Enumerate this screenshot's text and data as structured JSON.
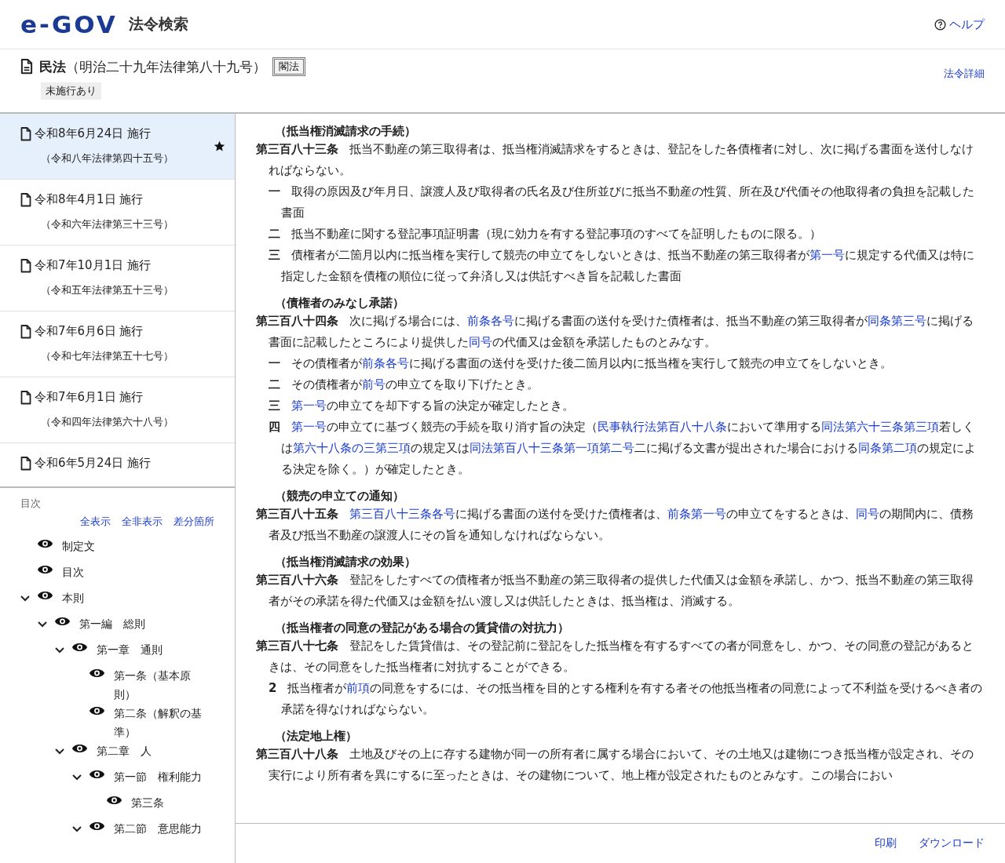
{
  "header": {
    "logo": "e-GOV",
    "service": "法令検索",
    "help": "ヘルプ"
  },
  "law": {
    "title": "**民法**（明治二十九年法律第八十九号）",
    "badge": "閣法",
    "tag": "未施行あり",
    "detail_link": "法令詳細"
  },
  "versions": [
    {
      "date": "令和8年6月24日 施行",
      "law_no": "（令和八年法律第四十五号）",
      "selected": true,
      "starred": true
    },
    {
      "date": "令和8年4月1日 施行",
      "law_no": "（令和六年法律第三十三号）",
      "selected": false,
      "starred": false
    },
    {
      "date": "令和7年10月1日 施行",
      "law_no": "（令和五年法律第五十三号）",
      "selected": false,
      "starred": false
    },
    {
      "date": "令和7年6月6日 施行",
      "law_no": "（令和七年法律第五十七号）",
      "selected": false,
      "starred": false
    },
    {
      "date": "令和7年6月1日 施行",
      "law_no": "（令和四年法律第六十八号）",
      "selected": false,
      "starred": false
    },
    {
      "date": "令和6年5月24日 施行",
      "selected": false,
      "starred": false
    }
  ],
  "toc": {
    "heading": "目次",
    "actions": [
      "全表示",
      "全非表示",
      "差分箇所"
    ],
    "items": [
      {
        "label": "制定文"
      },
      {
        "label": "目次"
      },
      {
        "label": "本則",
        "expanded": true,
        "children": [
          {
            "label": "第一編　総則",
            "expanded": true,
            "children": [
              {
                "label": "第一章　通則",
                "expanded": true,
                "children": [
                  {
                    "label": "第一条（基本原則）"
                  },
                  {
                    "label": "第二条（解釈の基準）"
                  }
                ]
              },
              {
                "label": "第二章　人",
                "expanded": true,
                "children": [
                  {
                    "label": "第一節　権利能力",
                    "expanded": true,
                    "children": [
                      {
                        "label": "第三条"
                      }
                    ]
                  },
                  {
                    "label": "第二節　意思能力",
                    "expanded": true
                  }
                ]
              }
            ]
          }
        ]
      }
    ]
  },
  "articles": [
    {
      "caption": "（抵当権消滅請求の手続）",
      "title": "第三百八十三条",
      "text": [
        {
          "kind": "text",
          "text": "抵当不動産の第三取得者は、抵当権消滅請求をするときは、登記をした各債権者に対し、次に掲げる書面を送付しなければならない。"
        }
      ],
      "items": [
        {
          "label": "一",
          "text": [
            {
              "kind": "text",
              "text": "取得の原因及び年月日、譲渡人及び取得者の氏名及び住所並びに抵当不動産の性質、所在及び代価その他取得者の負担を記載した書面"
            }
          ]
        },
        {
          "label": "二",
          "text": [
            {
              "kind": "text",
              "text": "抵当不動産に関する登記事項証明書（現に効力を有する登記事項のすべてを証明したものに限る。）"
            }
          ]
        },
        {
          "label": "三",
          "text": [
            {
              "kind": "text",
              "text": "債権者が二箇月以内に抵当権を実行して競売の申立てをしないときは、抵当不動産の第三取得者が"
            },
            {
              "kind": "link",
              "text": "第一号"
            },
            {
              "kind": "text",
              "text": "に規定する代価又は特に指定した金額を債権の順位に従って弁済し又は供託すべき旨を記載した書面"
            }
          ]
        }
      ]
    },
    {
      "caption": "（債権者のみなし承諾）",
      "title": "第三百八十四条",
      "text": [
        {
          "kind": "text",
          "text": "次に掲げる場合には、"
        },
        {
          "kind": "link",
          "text": "前条各号"
        },
        {
          "kind": "text",
          "text": "に掲げる書面の送付を受けた債権者は、抵当不動産の第三取得者が"
        },
        {
          "kind": "link",
          "text": "同条第三号"
        },
        {
          "kind": "text",
          "text": "に掲げる書面に記載したところにより提供した"
        },
        {
          "kind": "link",
          "text": "同号"
        },
        {
          "kind": "text",
          "text": "の代価又は金額を承諾したものとみなす。"
        }
      ],
      "items": [
        {
          "label": "一",
          "text": [
            {
              "kind": "text",
              "text": "その債権者が"
            },
            {
              "kind": "link",
              "text": "前条各号"
            },
            {
              "kind": "text",
              "text": "に掲げる書面の送付を受けた後二箇月以内に抵当権を実行して競売の申立てをしないとき。"
            }
          ]
        },
        {
          "label": "二",
          "text": [
            {
              "kind": "text",
              "text": "その債権者が"
            },
            {
              "kind": "link",
              "text": "前号"
            },
            {
              "kind": "text",
              "text": "の申立てを取り下げたとき。"
            }
          ]
        },
        {
          "label": "三",
          "text": [
            {
              "kind": "link",
              "text": "第一号"
            },
            {
              "kind": "text",
              "text": "の申立てを却下する旨の決定が確定したとき。"
            }
          ]
        },
        {
          "label": "四",
          "text": [
            {
              "kind": "link",
              "text": "第一号"
            },
            {
              "kind": "text",
              "text": "の申立てに基づく競売の手続を取り消す旨の決定（"
            },
            {
              "kind": "link",
              "text": "民事執行法第百八十八条"
            },
            {
              "kind": "text",
              "text": "において準用する"
            },
            {
              "kind": "link",
              "text": "同法第六十三条第三項"
            },
            {
              "kind": "text",
              "text": "若しくは"
            },
            {
              "kind": "link",
              "text": "第六十八条の三第三項"
            },
            {
              "kind": "text",
              "text": "の規定又は"
            },
            {
              "kind": "link",
              "text": "同法第百八十三条第一項第二号"
            },
            {
              "kind": "text",
              "text": "二に掲げる文書が提出された場合における"
            },
            {
              "kind": "link",
              "text": "同条第二項"
            },
            {
              "kind": "text",
              "text": "の規定による決定を除く。）が確定したとき。"
            }
          ]
        }
      ]
    },
    {
      "caption": "（競売の申立ての通知）",
      "title": "第三百八十五条",
      "text": [
        {
          "kind": "link",
          "text": "第三百八十三条各号"
        },
        {
          "kind": "text",
          "text": "に掲げる書面の送付を受けた債権者は、"
        },
        {
          "kind": "link",
          "text": "前条第一号"
        },
        {
          "kind": "text",
          "text": "の申立てをするときは、"
        },
        {
          "kind": "link",
          "text": "同号"
        },
        {
          "kind": "text",
          "text": "の期間内に、債務者及び抵当不動産の譲渡人にその旨を通知しなければならない。"
        }
      ]
    },
    {
      "caption": "（抵当権消滅請求の効果）",
      "title": "第三百八十六条",
      "text": [
        {
          "kind": "text",
          "text": "登記をしたすべての債権者が抵当不動産の第三取得者の提供した代価又は金額を承諾し、かつ、抵当不動産の第三取得者がその承諾を得た代価又は金額を払い渡し又は供託したときは、抵当権は、消滅する。"
        }
      ]
    },
    {
      "caption": "（抵当権者の同意の登記がある場合の賃貸借の対抗力）",
      "title": "第三百八十七条",
      "text": [
        {
          "kind": "text",
          "text": "登記をした賃貸借は、その登記前に登記をした抵当権を有するすべての者が同意をし、かつ、その同意の登記があるときは、その同意をした抵当権者に対抗することができる。"
        }
      ],
      "items": [
        {
          "label": "2",
          "text": [
            {
              "kind": "text",
              "text": "抵当権者が"
            },
            {
              "kind": "link",
              "text": "前項"
            },
            {
              "kind": "text",
              "text": "の同意をするには、その抵当権を目的とする権利を有する者その他抵当権者の同意によって不利益を受けるべき者の承諾を得なければならない。"
            }
          ]
        }
      ]
    },
    {
      "caption": "（法定地上権）",
      "title": "第三百八十八条",
      "text": [
        {
          "kind": "text",
          "text": "土地及びその上に存する建物が同一の所有者に属する場合において、その土地又は建物につき抵当権が設定され、その実行により所有者を異にするに至ったときは、その建物について、地上権が設定されたものとみなす。この場合におい"
        }
      ]
    }
  ],
  "footer": [
    "印刷",
    "ダウンロード"
  ]
}
